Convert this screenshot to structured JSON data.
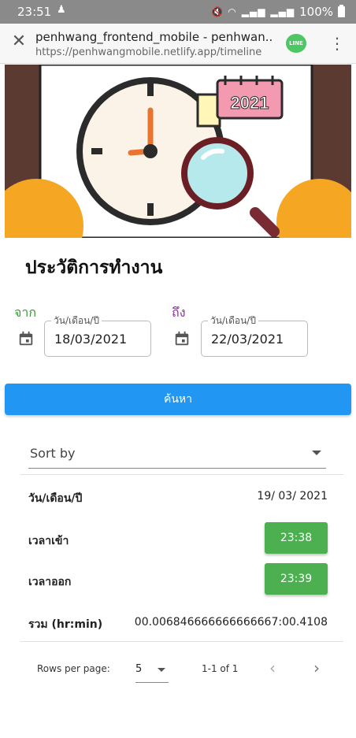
{
  "status_bar": {
    "time": "23:51",
    "battery": "100%"
  },
  "browser": {
    "page_title": "penhwang_frontend_mobile - penhwan...",
    "url": "https://penhwangmobile.netlify.app/timeline",
    "line_label": "LINE"
  },
  "hero": {
    "calendar_year": "2021"
  },
  "page": {
    "title": "ประวัติการทำงาน"
  },
  "filters": {
    "from_label": "จาก",
    "to_label": "ถึง",
    "date_field_label": "วัน/เดือน/ปี",
    "from_value": "18/03/2021",
    "to_value": "22/03/2021",
    "search_label": "ค้นหา",
    "sort_placeholder": "Sort by"
  },
  "record": {
    "date_label": "วัน/เดือน/ปี",
    "date_value": "19/ 03/ 2021",
    "checkin_label": "เวลาเข้า",
    "checkin_value": "23:38",
    "checkout_label": "เวลาออก",
    "checkout_value": "23:39",
    "total_label": "รวม (hr:min)",
    "total_value": "00.006846666666666667:00.4108"
  },
  "pagination": {
    "rows_per_page_label": "Rows per page:",
    "rows_per_page_value": "5",
    "range": "1-1 of 1"
  },
  "colors": {
    "primary": "#2196f3",
    "success": "#4caf50",
    "from_label": "#3a9a3a",
    "to_label": "#9c27b0"
  }
}
